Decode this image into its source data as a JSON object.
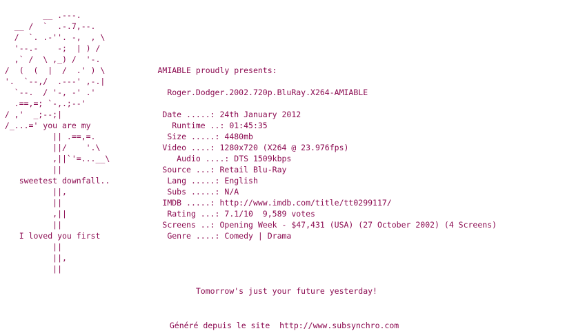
{
  "colors": {
    "text": "#8b0a50",
    "background": "#ffffff"
  },
  "nfo_lines": [
    "         __ .---.",
    "   __ /  `  .-.7,--.",
    "   /  `. .-''. -,  , \\",
    "   '--.-    -;  | ) /",
    "   ,` /  \\ ,_) /  '-.",
    " /  (  (  |  /  .' ) \\           AMIABLE proudly presents:",
    " '.  `--,/  .---' ,-.|",
    "   `--.  / '-, -' .'               Roger.Dodger.2002.720p.BluRay.X264-AMIABLE",
    "   .==,=; `-,.;--'",
    " / ,'  _;--;|                     Date .....: 24th January 2012",
    " /_...=' you are my                 Runtime ..: 01:45:35",
    "           || .==,=.               Size .....: 4480mb",
    "           ||/    '.\\             Video ....: 1280x720 (X264 @ 23.976fps)",
    "           ,||`'=...__\\              Audio ....: DTS 1509kbps",
    "           ||                     Source ...: Retail Blu-Ray",
    "    sweetest downfall..            Lang .....: English",
    "           ||,                     Subs .....: N/A",
    "           ||                     IMDB .....: http://www.imdb.com/title/tt0299117/",
    "           ,||                     Rating ...: 7.1/10  9,589 votes",
    "           ||                     Screens ..: Opening Week - $47,431 (USA) (27 October 2002) (4 Screens)",
    "    I loved you first              Genre ....: Comedy | Drama",
    "           ||",
    "           ||,",
    "           ||",
    "",
    "                                         Tomorrow's just your future yesterday!"
  ],
  "footer": {
    "prefix": "Généré depuis le site  ",
    "link": "http://www.subsynchro.com"
  }
}
